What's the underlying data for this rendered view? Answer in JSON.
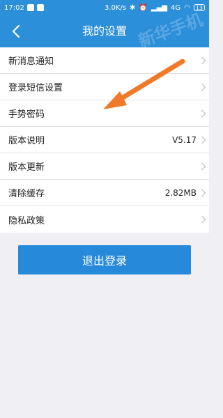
{
  "status_bar": {
    "time": "17:02",
    "network_speed": "3.0K/s",
    "network_type": "4G",
    "battery": "13"
  },
  "header": {
    "title": "我的设置"
  },
  "settings": [
    {
      "label": "新消息通知",
      "value": ""
    },
    {
      "label": "登录短信设置",
      "value": ""
    },
    {
      "label": "手势密码",
      "value": ""
    },
    {
      "label": "版本说明",
      "value": "V5.17"
    },
    {
      "label": "版本更新",
      "value": ""
    },
    {
      "label": "清除缓存",
      "value": "2.82MB"
    },
    {
      "label": "隐私政策",
      "value": ""
    }
  ],
  "logout_label": "退出登录",
  "watermark": "新华手机",
  "colors": {
    "brand_blue": "#2c8fd9",
    "button_blue": "#2689d9",
    "page_bg": "#efeff4",
    "annotation_arrow": "#f07a2a"
  },
  "icons": [
    "back-arrow-icon",
    "chevron-right-icon",
    "annotation-arrow"
  ]
}
